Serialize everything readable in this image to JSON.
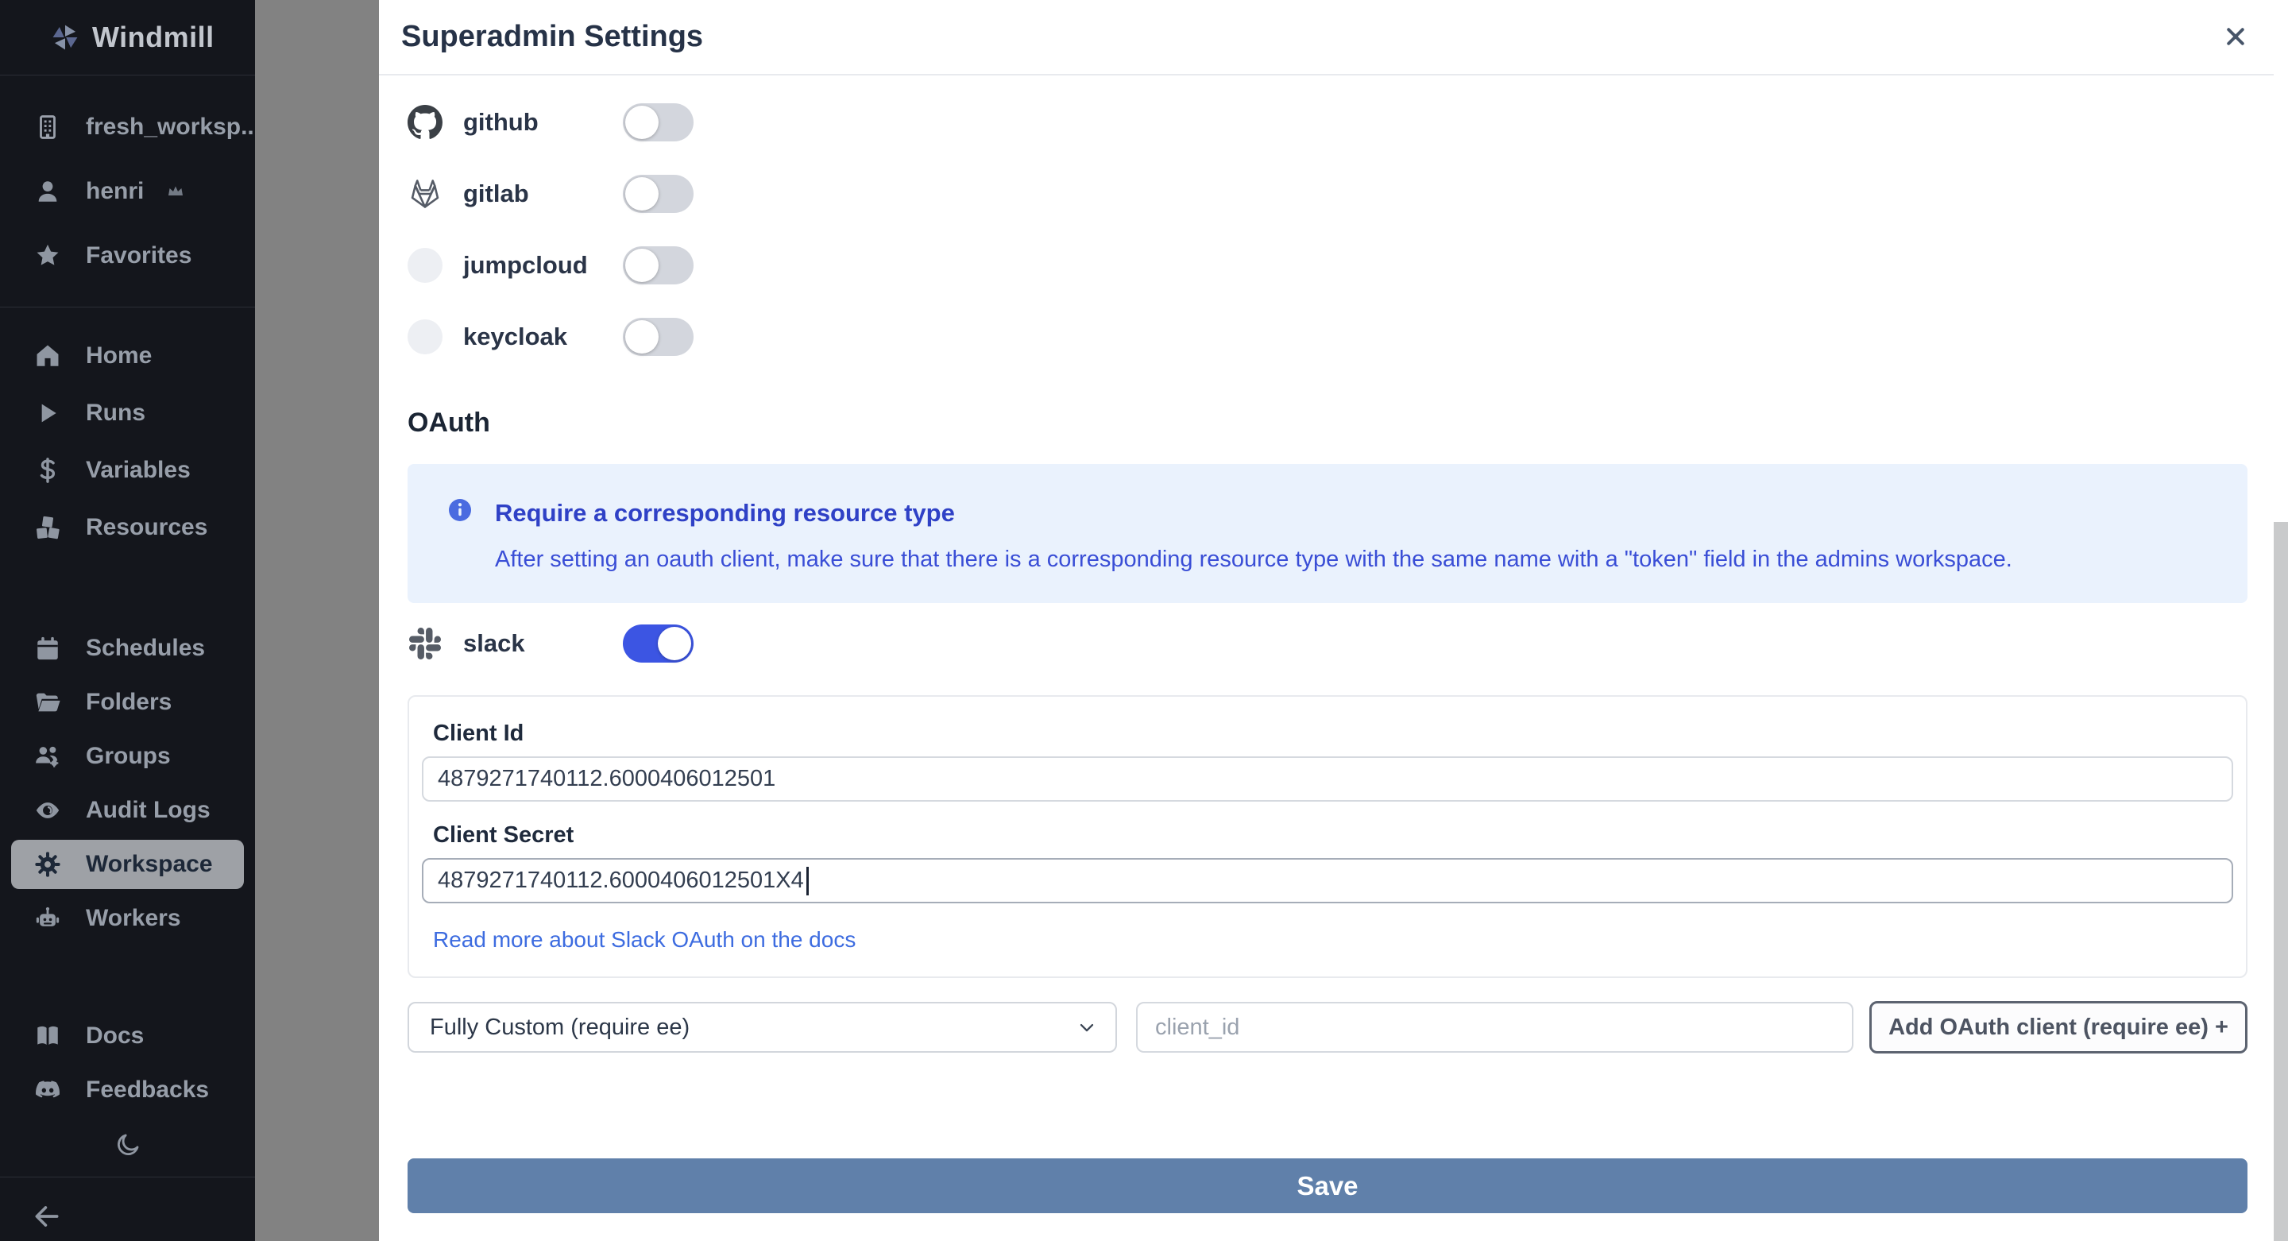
{
  "sidebar": {
    "logo": "Windmill",
    "workspace": "fresh_worksp...",
    "user": "henri",
    "favorites": "Favorites",
    "nav_top": [
      {
        "label": "Home"
      },
      {
        "label": "Runs"
      },
      {
        "label": "Variables"
      },
      {
        "label": "Resources"
      }
    ],
    "nav_admin": [
      {
        "label": "Schedules"
      },
      {
        "label": "Folders"
      },
      {
        "label": "Groups"
      },
      {
        "label": "Audit Logs"
      },
      {
        "label": "Workspace",
        "active": true
      },
      {
        "label": "Workers"
      }
    ],
    "nav_bottom": [
      {
        "label": "Docs"
      },
      {
        "label": "Feedbacks"
      }
    ]
  },
  "modal": {
    "title": "Superadmin Settings",
    "providers": [
      {
        "name": "github",
        "enabled": false
      },
      {
        "name": "gitlab",
        "enabled": false
      },
      {
        "name": "jumpcloud",
        "enabled": false
      },
      {
        "name": "keycloak",
        "enabled": false
      }
    ],
    "oauth": {
      "heading": "OAuth",
      "info_title": "Require a corresponding resource type",
      "info_body": "After setting an oauth client, make sure that there is a corresponding resource type with the same name with a \"token\" field in the admins workspace.",
      "slack": {
        "name": "slack",
        "enabled": true,
        "client_id_label": "Client Id",
        "client_id": "4879271740112.6000406012501",
        "client_secret_label": "Client Secret",
        "client_secret": "4879271740112.6000406012501X4",
        "docs_link": "Read more about Slack OAuth on the docs"
      },
      "custom": {
        "select_value": "Fully Custom (require ee)",
        "input_placeholder": "client_id",
        "add_button": "Add OAuth client (require ee) +"
      }
    },
    "save_label": "Save"
  },
  "colors": {
    "accent_blue": "#3c55e3",
    "save_button": "#6080aa",
    "link": "#3d6ce0",
    "info_bg": "#eaf2fd",
    "info_text": "#3a4ed6",
    "sidebar_bg": "#14161c",
    "backdrop": "#828282"
  }
}
